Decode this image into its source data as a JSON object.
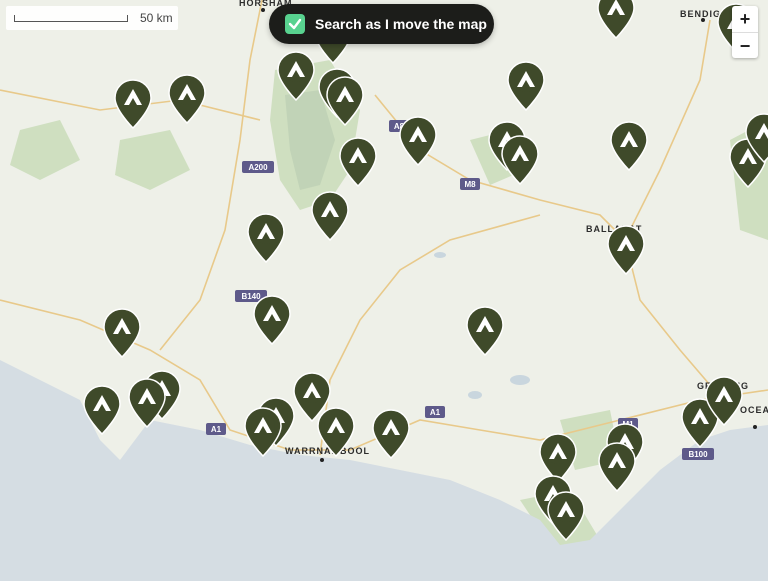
{
  "map": {
    "scale_label": "50 km",
    "search_toggle": {
      "label": "Search as I move the map",
      "checked": true
    },
    "zoom_in_label": "+",
    "zoom_out_label": "−",
    "places": [
      {
        "name": "HORSHAM"
      },
      {
        "name": "BENDIGO"
      },
      {
        "name": "BALLARAT"
      },
      {
        "name": "WARRNAMBOOL"
      },
      {
        "name": "GEELONG"
      },
      {
        "name": "OCEAN GROVE"
      }
    ],
    "road_shields": [
      "A200",
      "A8",
      "M8",
      "B140",
      "A1",
      "A1",
      "M1",
      "B100"
    ],
    "colors": {
      "land": "#eef0e8",
      "sea": "#d5dde3",
      "park": "#cfdfc0",
      "pin": "#3f4a2a",
      "pill": "#1c1d1a",
      "check": "#58d28f"
    },
    "marker_icon": "campsite-tent-icon",
    "campsite_marker_count": 40
  }
}
